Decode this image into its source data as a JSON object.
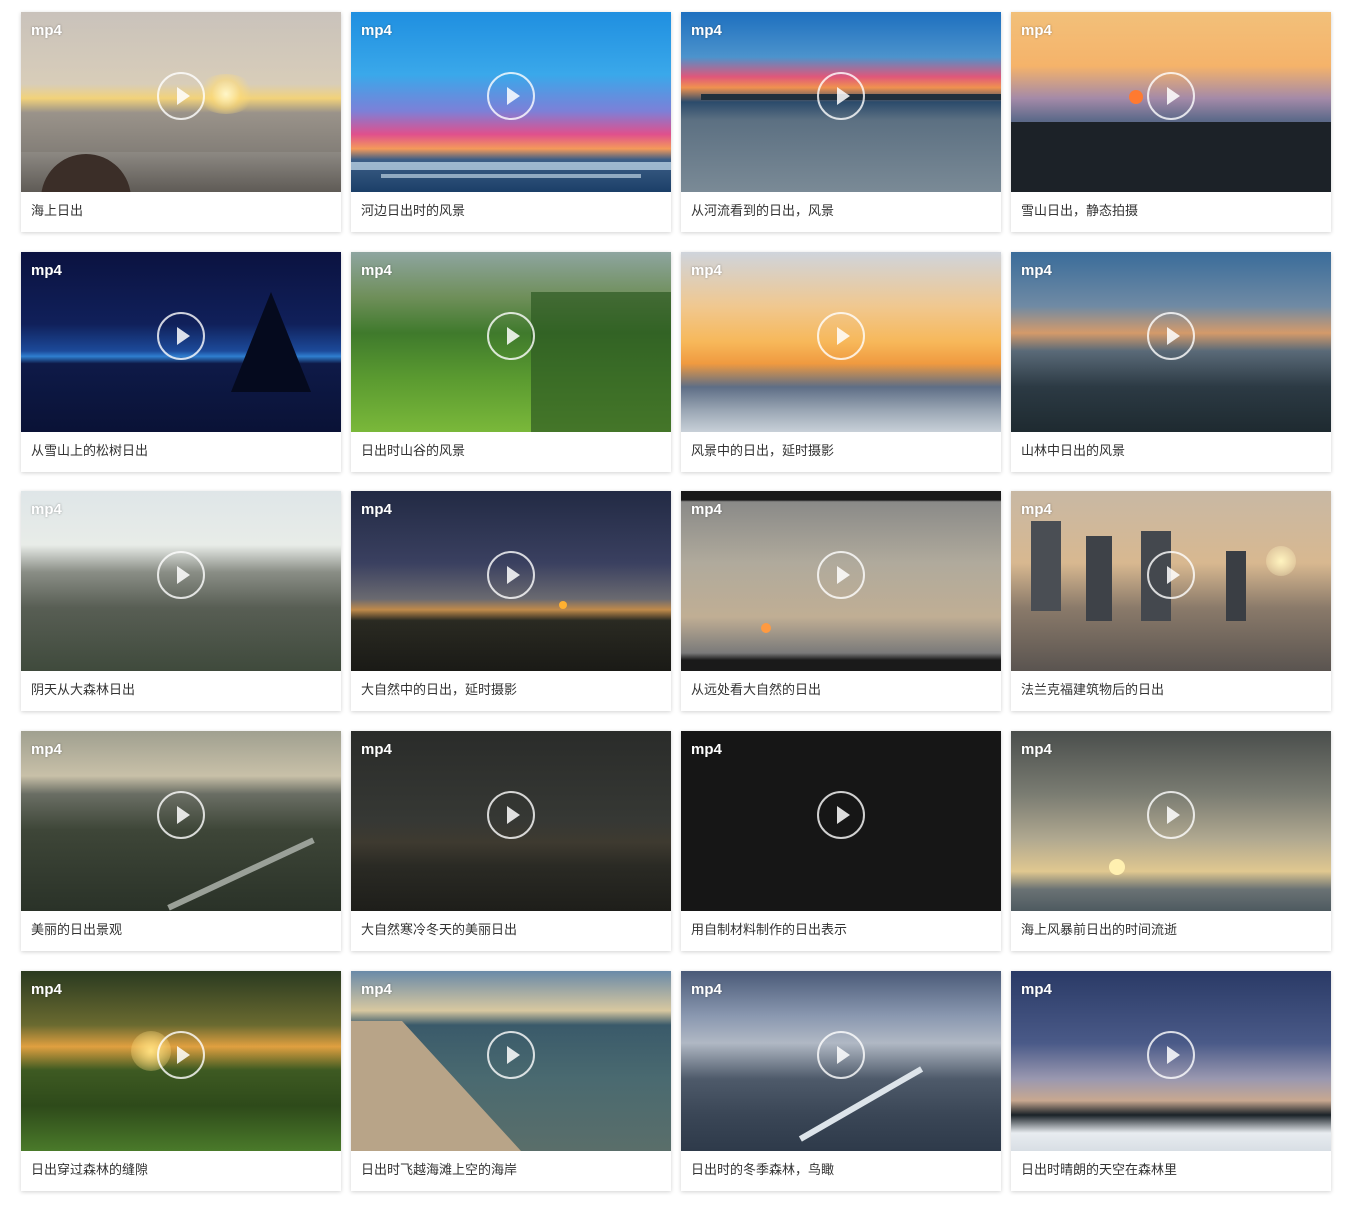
{
  "page": {
    "play_icon": "play-icon",
    "play_ring_color": "#ffffff",
    "caption_color": "#333333"
  },
  "videos": [
    {
      "format": "mp4",
      "title": "海上日出"
    },
    {
      "format": "mp4",
      "title": "河边日出时的风景"
    },
    {
      "format": "mp4",
      "title": "从河流看到的日出，风景"
    },
    {
      "format": "mp4",
      "title": "雪山日出，静态拍摄"
    },
    {
      "format": "mp4",
      "title": "从雪山上的松树日出"
    },
    {
      "format": "mp4",
      "title": "日出时山谷的风景"
    },
    {
      "format": "mp4",
      "title": "风景中的日出，延时摄影"
    },
    {
      "format": "mp4",
      "title": "山林中日出的风景"
    },
    {
      "format": "mp4",
      "title": "阴天从大森林日出"
    },
    {
      "format": "mp4",
      "title": "大自然中的日出，延时摄影"
    },
    {
      "format": "mp4",
      "title": "从远处看大自然的日出"
    },
    {
      "format": "mp4",
      "title": "法兰克福建筑物后的日出"
    },
    {
      "format": "mp4",
      "title": "美丽的日出景观"
    },
    {
      "format": "mp4",
      "title": "大自然寒冷冬天的美丽日出"
    },
    {
      "format": "mp4",
      "title": "用自制材料制作的日出表示"
    },
    {
      "format": "mp4",
      "title": "海上风暴前日出的时间流逝"
    },
    {
      "format": "mp4",
      "title": "日出穿过森林的缝隙"
    },
    {
      "format": "mp4",
      "title": "日出时飞越海滩上空的海岸"
    },
    {
      "format": "mp4",
      "title": "日出时的冬季森林，鸟瞰"
    },
    {
      "format": "mp4",
      "title": "日出时晴朗的天空在森林里"
    }
  ]
}
